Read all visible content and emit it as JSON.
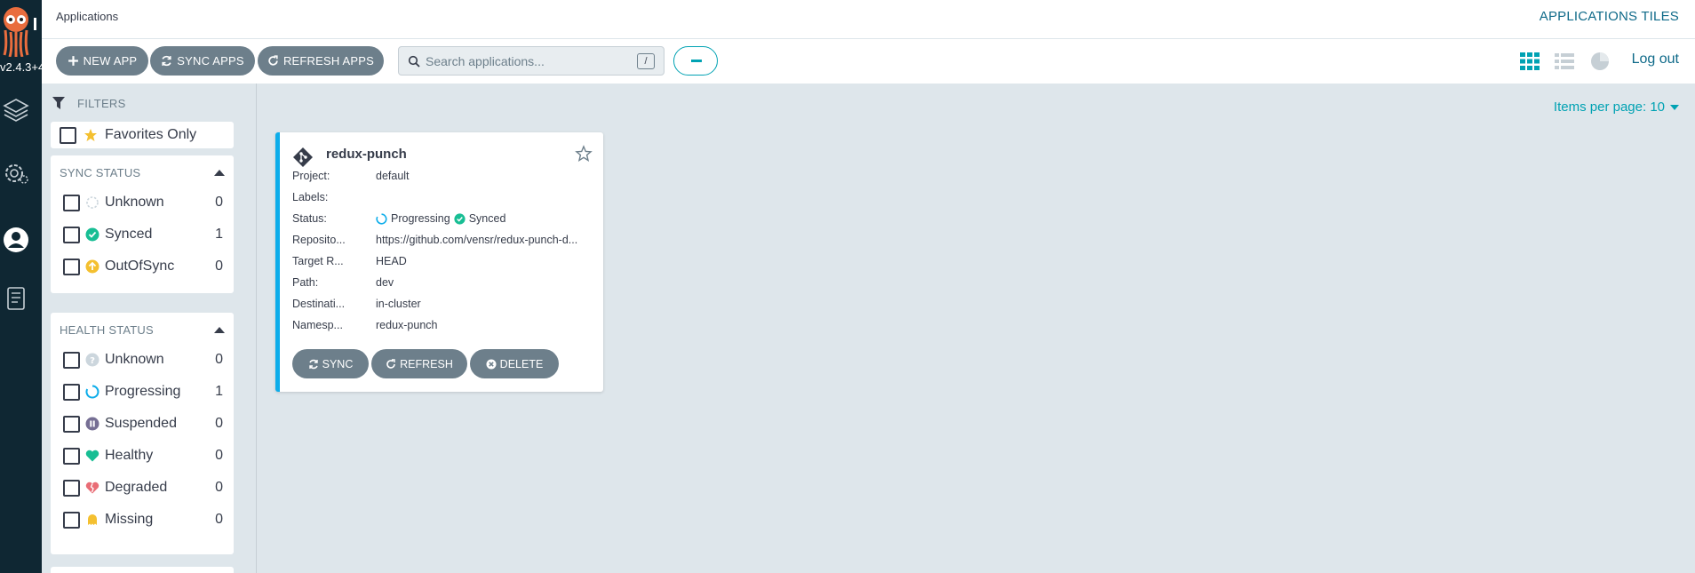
{
  "nav": {
    "version": "v2.4.3+4",
    "items": [
      "layers-icon",
      "gear-icon",
      "user-icon",
      "docs-icon"
    ]
  },
  "topbar": {
    "title": "Applications",
    "right_title": "APPLICATIONS TILES"
  },
  "toolbar": {
    "new_app": "NEW APP",
    "sync_apps": "SYNC APPS",
    "refresh_apps": "REFRESH APPS",
    "search_placeholder": "Search applications...",
    "search_shortcut": "/",
    "logout": "Log out"
  },
  "filters": {
    "title": "FILTERS",
    "favorites_label": "Favorites Only",
    "sync_status": {
      "title": "SYNC STATUS",
      "items": [
        {
          "label": "Unknown",
          "count": "0"
        },
        {
          "label": "Synced",
          "count": "1"
        },
        {
          "label": "OutOfSync",
          "count": "0"
        }
      ]
    },
    "health_status": {
      "title": "HEALTH STATUS",
      "items": [
        {
          "label": "Unknown",
          "count": "0"
        },
        {
          "label": "Progressing",
          "count": "1"
        },
        {
          "label": "Suspended",
          "count": "0"
        },
        {
          "label": "Healthy",
          "count": "0"
        },
        {
          "label": "Degraded",
          "count": "0"
        },
        {
          "label": "Missing",
          "count": "0"
        }
      ]
    }
  },
  "pagination": {
    "items_per_page": "Items per page: 10"
  },
  "app": {
    "name": "redux-punch",
    "rows": [
      {
        "key": "Project:",
        "value": "default"
      },
      {
        "key": "Labels:",
        "value": ""
      },
      {
        "key": "Status:",
        "health": "Progressing",
        "sync": "Synced"
      },
      {
        "key": "Reposito...",
        "value": "https://github.com/vensr/redux-punch-d..."
      },
      {
        "key": "Target R...",
        "value": "HEAD"
      },
      {
        "key": "Path:",
        "value": "dev"
      },
      {
        "key": "Destinati...",
        "value": "in-cluster"
      },
      {
        "key": "Namesp...",
        "value": "redux-punch"
      }
    ],
    "buttons": {
      "sync": "SYNC",
      "refresh": "REFRESH",
      "delete": "DELETE"
    }
  },
  "colors": {
    "nav_bg": "#0f2733",
    "accent": "#00a2b3",
    "button_bg": "#6d7f8b",
    "synced": "#18be94",
    "out_of_sync": "#f4c030",
    "degraded": "#e96d76",
    "tile_border": "#0dadea"
  }
}
